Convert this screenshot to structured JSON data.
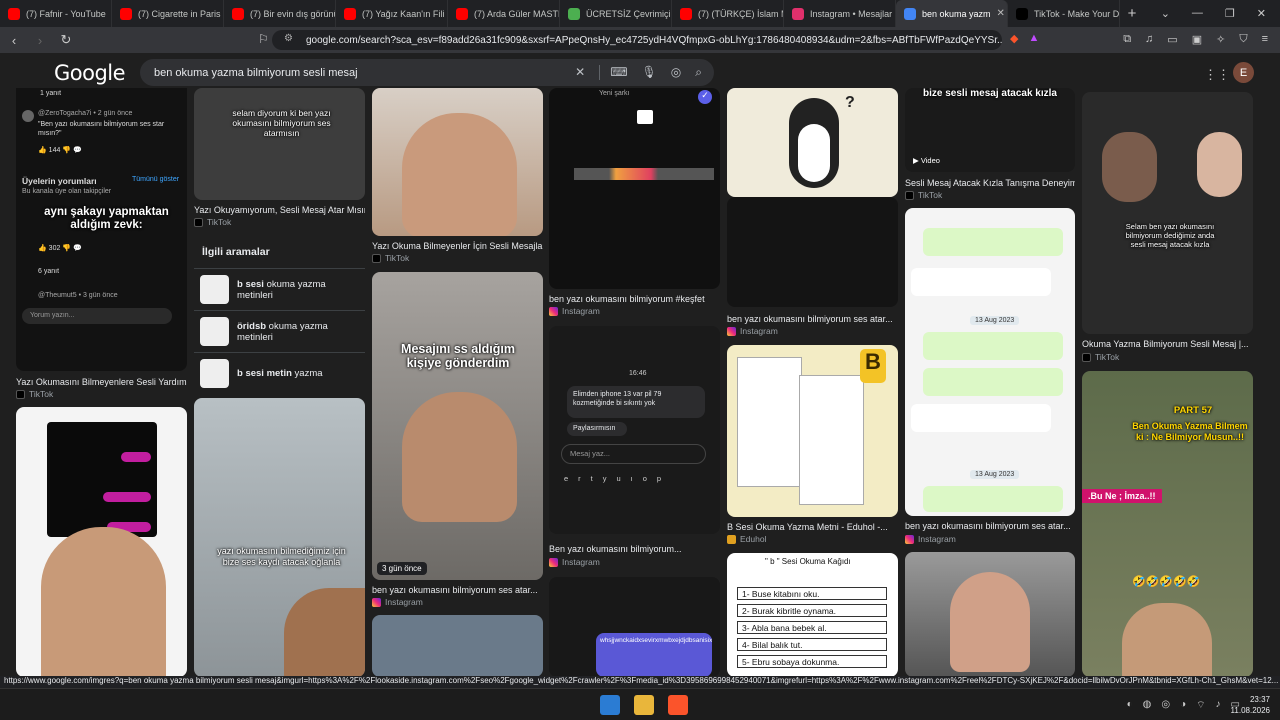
{
  "tabs": [
    {
      "title": "(7) Fafnir - YouTube",
      "fav": "#ff0000"
    },
    {
      "title": "(7) Cigarette in Paris |",
      "fav": "#ff0000"
    },
    {
      "title": "(7) Bir evin dış görünü",
      "fav": "#ff0000"
    },
    {
      "title": "(7) Yağız Kaan'ın Fili S",
      "fav": "#ff0000"
    },
    {
      "title": "(7) Arda Güler MASTE",
      "fav": "#ff0000"
    },
    {
      "title": "ÜCRETSİZ Çevrimiçi Sı",
      "fav": "#4caf50"
    },
    {
      "title": "(7) (TÜRKÇE) İslam M",
      "fav": "#ff0000"
    },
    {
      "title": "Instagram • Mesajlar",
      "fav": "#e1306c"
    },
    {
      "title": "ben okuma yazm",
      "fav": "#4285f4",
      "active": true
    },
    {
      "title": "TikTok - Make Your Da",
      "fav": "#000000"
    }
  ],
  "address": {
    "url": "google.com/search?sca_esv=f89add26a31fc909&sxsrf=APpeQnsHy_ec4725ydH4VQfmpxG-obLhYg:1786480408934&udm=2&fbs=ABfTbFWfPazdQeYYSr..."
  },
  "google": {
    "logo": "Google",
    "query": "ben okuma yazma bilmiyorum sesli mesaj",
    "avatar_letter": "E"
  },
  "comments_panel": {
    "reply1": "1 yanıt",
    "user1": "@ZeroTogacha7i • 2 gün önce",
    "comment1": "\"Ben yazı okumasını bilmiyorum ses star mısın?\"",
    "likes1": "144",
    "section": "Üyelerin yorumları",
    "show_all": "Tümünü göster",
    "section_sub": "Bu kanala üye olan takipçiler",
    "overlay": "aynı şakayı yapmaktan aldığım zevk:",
    "likes2": "302",
    "replies2": "6 yanıt",
    "user3": "@Theumut5 • 3 gün önce",
    "input_placeholder": "Yorum yazın..."
  },
  "related": {
    "header": "İlgili aramalar",
    "items": [
      {
        "bold": "b sesi",
        "rest": " okuma yazma metinleri"
      },
      {
        "bold": "öridsb",
        "rest": " okuma yazma metinleri"
      },
      {
        "bold": "b sesi metin",
        "rest": " yazma"
      }
    ]
  },
  "results": {
    "c1_caption": "Yazı Okumasını Bilmeyenlere Sesli Yardım |...",
    "c1_source": "TikTok",
    "c2_overlay": "selam diyorum ki ben yazı okumasını bilmiyorum ses atarmısın",
    "c2_caption": "Yazı Okuyamıyorum, Sesli Mesaj Atar Mısın...",
    "c2_source": "TikTok",
    "c2b_overlay": "yazı okumasını bilmediğimiz için bize ses kaydı atacak oğlanla",
    "c3_caption": "Yazı Okuma Bilmeyenler İçin Sesli Mesajlar...",
    "c3_source": "TikTok",
    "c3b_overlay": "Mesajını ss aldığım kişiye gönderdim",
    "c3b_badge": "3 gün önce",
    "c3b_caption": "ben yazı okumasını bilmiyorum ses atar...",
    "c3b_source": "Instagram",
    "c4_song": "Yeni şarkı",
    "c4_caption": "ben yazı okumasını bilmiyorum #keşfet",
    "c4_source": "Instagram",
    "c4b_time": "16:46",
    "c4b_msg1": "Elimden iphone 13 var pil 79 kozmetiğinde bi sıkıntı yok",
    "c4b_msg2": "Paylasırmısın",
    "c4b_input": "Mesaj yaz...",
    "c4b_caption": "Ben yazı okumasını bilmiyorum...",
    "c4b_source": "Instagram",
    "c5_caption": "ben yazı okumasını bilmiyorum ses atar...",
    "c5_source": "Instagram",
    "c5b_caption": "B Sesi Okuma Yazma Metni - Eduhol -...",
    "c5b_source": "Eduhol",
    "c5c_title": "\" b \" Sesi Okuma Kağıdı",
    "c5c_lines": [
      "1- Buse kitabını oku.",
      "2- Burak kibritle oynama.",
      "3- Abla bana bebek al.",
      "4- Bilal balık tut.",
      "5- Ebru sobaya dokunma."
    ],
    "c6_overlay": "bize sesli mesaj atacak kızla",
    "c6_video": "Video",
    "c6_caption": "Sesli Mesaj Atacak Kızla Tanışma Deneyimi",
    "c6_source": "TikTok",
    "c6b_date1": "13 Aug 2023",
    "c6b_date2": "13 Aug 2023",
    "c6b_caption": "ben yazı okumasını bilmiyorum ses atar...",
    "c6b_source": "Instagram",
    "c7_overlay": "Selam ben yazı okumasını bilmiyorum dediğimiz anda sesli mesaj atacak kızla",
    "c7_caption": "Okuma Yazma Bilmiyorum Sesli Mesaj |...",
    "c7_source": "TikTok",
    "c7b_part": "PART 57",
    "c7b_line": "Ben Okuma Yazma Bilmem ki : Ne Bilmiyor Musun..!!",
    "c7b_tag": ".Bu Ne ; İmza..!!",
    "c7b_emoji": "🤣🤣🤣🤣🤣"
  },
  "statusbar": "https://www.google.com/imgres?q=ben okuma yazma bilmiyorum sesli mesaj&imgurl=https%3A%2F%2Flookaside.instagram.com%2Fseo%2Fgoogle_widget%2Fcrawler%2F%3Fmedia_id%3D3958696998452940071&imgrefurl=https%3A%2F%2Fwww.instagram.com%2Freel%2FDTCy-SXjKEJ%2F&docid=llbilwDvOrJPnM&tbnid=XGfLh-Ch1_GhsM&vet=12...",
  "clock": {
    "time": "23:37",
    "date": "11.08.2026"
  }
}
